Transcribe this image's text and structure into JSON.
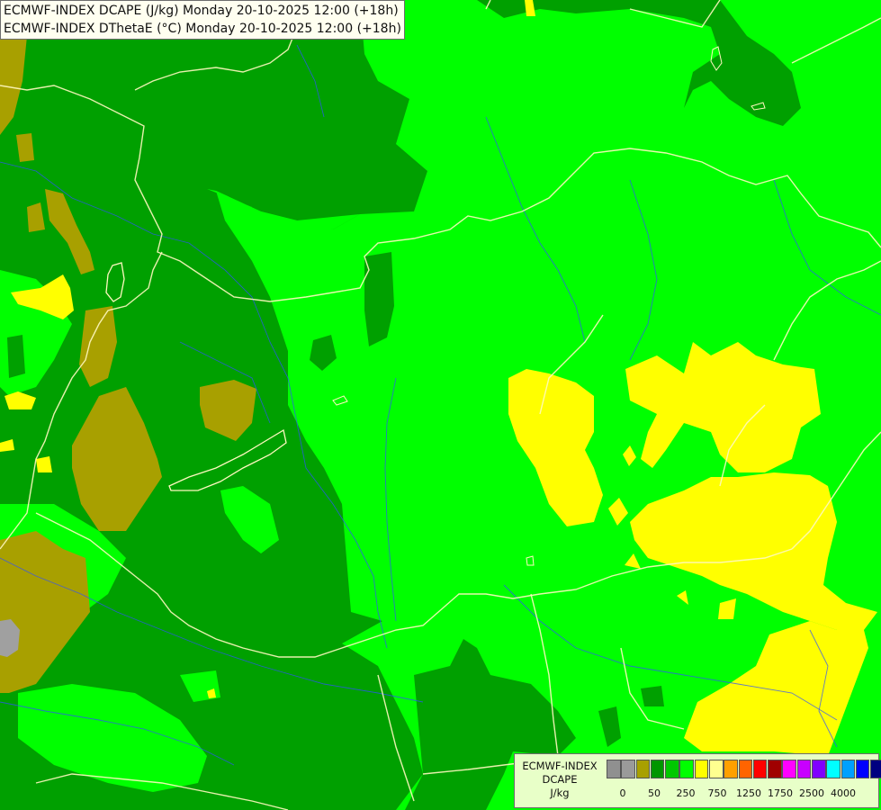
{
  "title": {
    "line1": "ECMWF-INDEX DCAPE (J/kg) Monday 20-10-2025 12:00 (+18h)",
    "line2": "ECMWF-INDEX DThetaE (°C) Monday 20-10-2025 12:00 (+18h)"
  },
  "legend": {
    "line1": "ECMWF-INDEX",
    "line2": "DCAPE",
    "line3": "J/kg",
    "swatches": [
      "#909090",
      "#9a9a9a",
      "#a8a000",
      "#009600",
      "#00c800",
      "#00ff00",
      "#ffff00",
      "#ffff90",
      "#ffa000",
      "#ff6400",
      "#ff0000",
      "#a00000",
      "#ff00ff",
      "#c800ff",
      "#8000ff",
      "#00ffff",
      "#00a0ff",
      "#0000ff",
      "#000080"
    ],
    "tick_labels": [
      "0",
      "50",
      "250",
      "750",
      "1250",
      "1750",
      "2500",
      "4000"
    ]
  },
  "colors": {
    "bright_green": "#00ff00",
    "dark_green": "#00a000",
    "olive": "#a8a000",
    "yellow": "#ffff00",
    "grey": "#a0a0a0",
    "border": "#ffffc0",
    "river": "#4060ff"
  }
}
